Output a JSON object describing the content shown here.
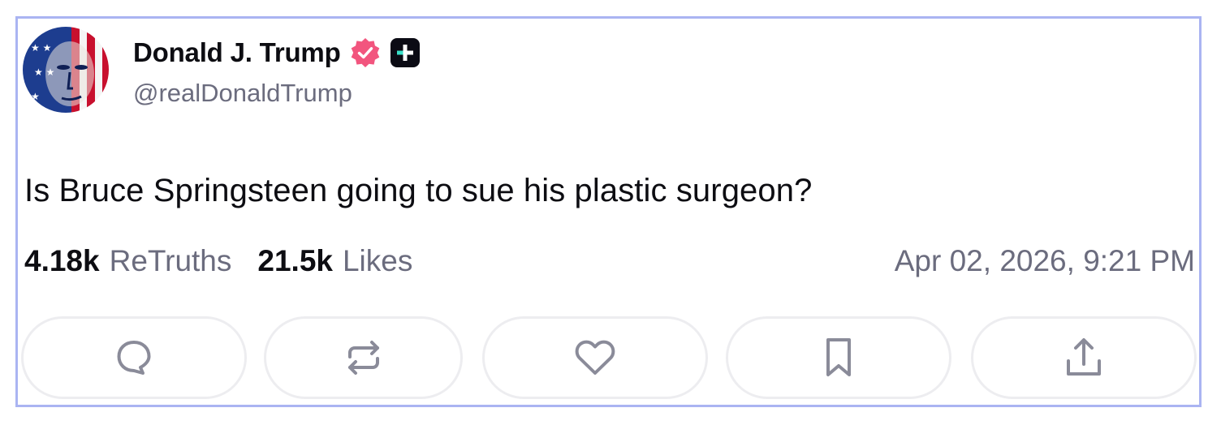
{
  "post": {
    "author": {
      "display_name": "Donald J. Trump",
      "handle": "@realDonaldTrump",
      "avatar_icon": "flag-portrait-avatar",
      "verified_icon": "verified-badge-icon",
      "plus_icon": "plus-badge-icon"
    },
    "text": "Is Bruce Springsteen going to sue his plastic surgeon?",
    "stats": {
      "retruths_count": "4.18k",
      "retruths_label": "ReTruths",
      "likes_count": "21.5k",
      "likes_label": "Likes"
    },
    "timestamp": "Apr 02, 2026, 9:21 PM"
  },
  "actions": [
    {
      "name": "reply",
      "icon": "comment-icon"
    },
    {
      "name": "retruth",
      "icon": "repost-icon"
    },
    {
      "name": "like",
      "icon": "heart-icon"
    },
    {
      "name": "bookmark",
      "icon": "bookmark-icon"
    },
    {
      "name": "share",
      "icon": "share-icon"
    }
  ],
  "colors": {
    "border": "#aab4f2",
    "verified": "#f2557e",
    "text": "#0d0d12",
    "muted": "#6b6c7e",
    "icon": "#8a8b99"
  }
}
